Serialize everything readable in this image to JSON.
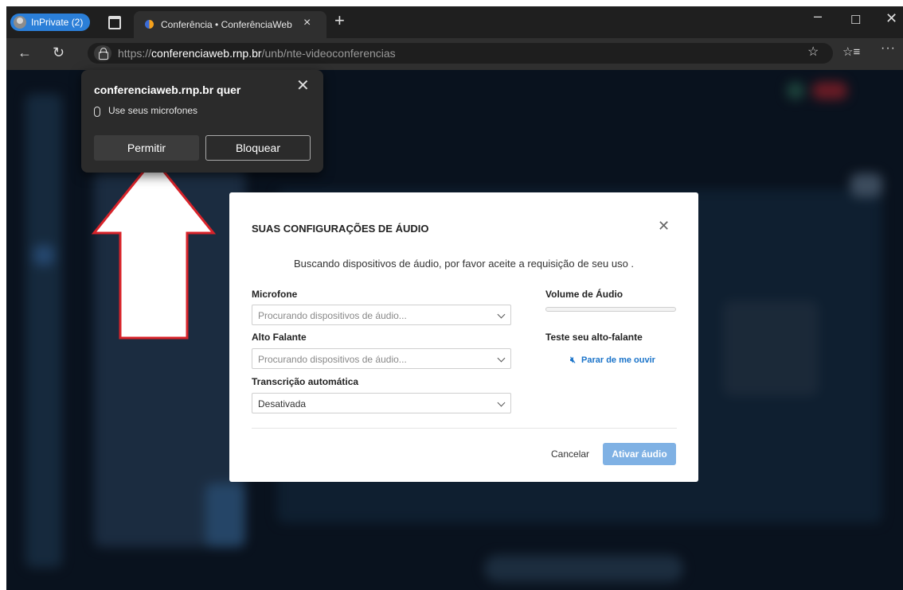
{
  "browser": {
    "profile_label": "InPrivate (2)",
    "tab_title": "Conferência • ConferênciaWeb",
    "tab_close": "×",
    "new_tab": "+",
    "url_scheme": "https://",
    "url_host": "conferenciaweb.rnp.br",
    "url_path": "/unb/nte-videoconferencias",
    "icons": [
      "profile-avatar-icon",
      "tab-actions-icon",
      "site-favicon",
      "back-arrow-icon",
      "refresh-icon",
      "lock-icon",
      "favorite-star-icon",
      "favorites-icon",
      "more-icon"
    ]
  },
  "permission": {
    "site": "conferenciaweb.rnp.br quer",
    "request": "Use seus microfones",
    "allow_label": "Permitir",
    "block_label": "Bloquear"
  },
  "modal": {
    "title": "SUAS CONFIGURAÇÕES DE ÁUDIO",
    "message": "Buscando dispositivos de áudio, por favor aceite a requisição de seu uso  .",
    "mic_label": "Microfone",
    "mic_value": "Procurando dispositivos de áudio...",
    "speaker_label": "Alto Falante",
    "speaker_value": "Procurando dispositivos de áudio...",
    "transcription_label": "Transcrição automática",
    "transcription_value": "Desativada",
    "volume_label": "Volume de Áudio",
    "volume_level": 0,
    "test_label": "Teste seu alto-falante",
    "stop_label": "Parar de me ouvir",
    "cancel_label": "Cancelar",
    "activate_label": "Ativar áudio"
  },
  "colors": {
    "accent": "#2b7fd8",
    "link": "#1a73c9",
    "activate_button": "#7fb1e4",
    "arrow_outline": "#d8232a"
  }
}
